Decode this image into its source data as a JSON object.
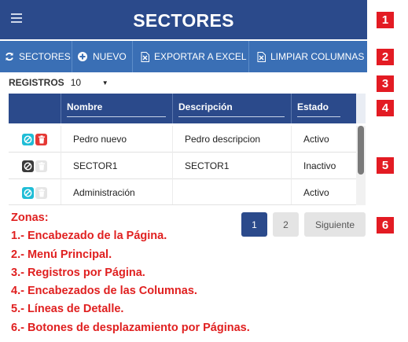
{
  "header": {
    "title": "SECTORES"
  },
  "menu": {
    "items": [
      {
        "label": "SECTORES",
        "icon": "refresh-icon"
      },
      {
        "label": "NUEVO",
        "icon": "plus-circle-icon"
      },
      {
        "label": "EXPORTAR A EXCEL",
        "icon": "excel-file-icon"
      },
      {
        "label": "LIMPIAR COLUMNAS",
        "icon": "excel-file-icon"
      }
    ]
  },
  "registros": {
    "label": "REGISTROS",
    "value": "10"
  },
  "table": {
    "columns": [
      "",
      "Nombre",
      "Descripción",
      "Estado"
    ],
    "rows": [
      {
        "nombre": "Pedro nuevo",
        "descripcion": "Pedro descripcion",
        "estado": "Activo"
      },
      {
        "nombre": "SECTOR1",
        "descripcion": "SECTOR1",
        "estado": "Inactivo"
      },
      {
        "nombre": "Administración",
        "descripcion": "",
        "estado": "Activo"
      }
    ]
  },
  "pager": {
    "page1": "1",
    "page2": "2",
    "next": "Siguiente"
  },
  "zones": {
    "title": "Zonas:",
    "items": [
      "1.- Encabezado de la Página.",
      "2.- Menú Principal.",
      "3.- Registros por Página.",
      "4.- Encabezados de las Columnas.",
      "5.- Líneas de Detalle.",
      "6.- Botones de desplazamiento por Páginas."
    ]
  },
  "badges": [
    "1",
    "2",
    "3",
    "4",
    "5",
    "6"
  ],
  "colors": {
    "header": "#2b4a8b",
    "menu": "#3a6fb5",
    "badge": "#e31b23",
    "zones_text": "#e02020",
    "cyan_action": "#1fbdd6",
    "red_action": "#e53935"
  }
}
